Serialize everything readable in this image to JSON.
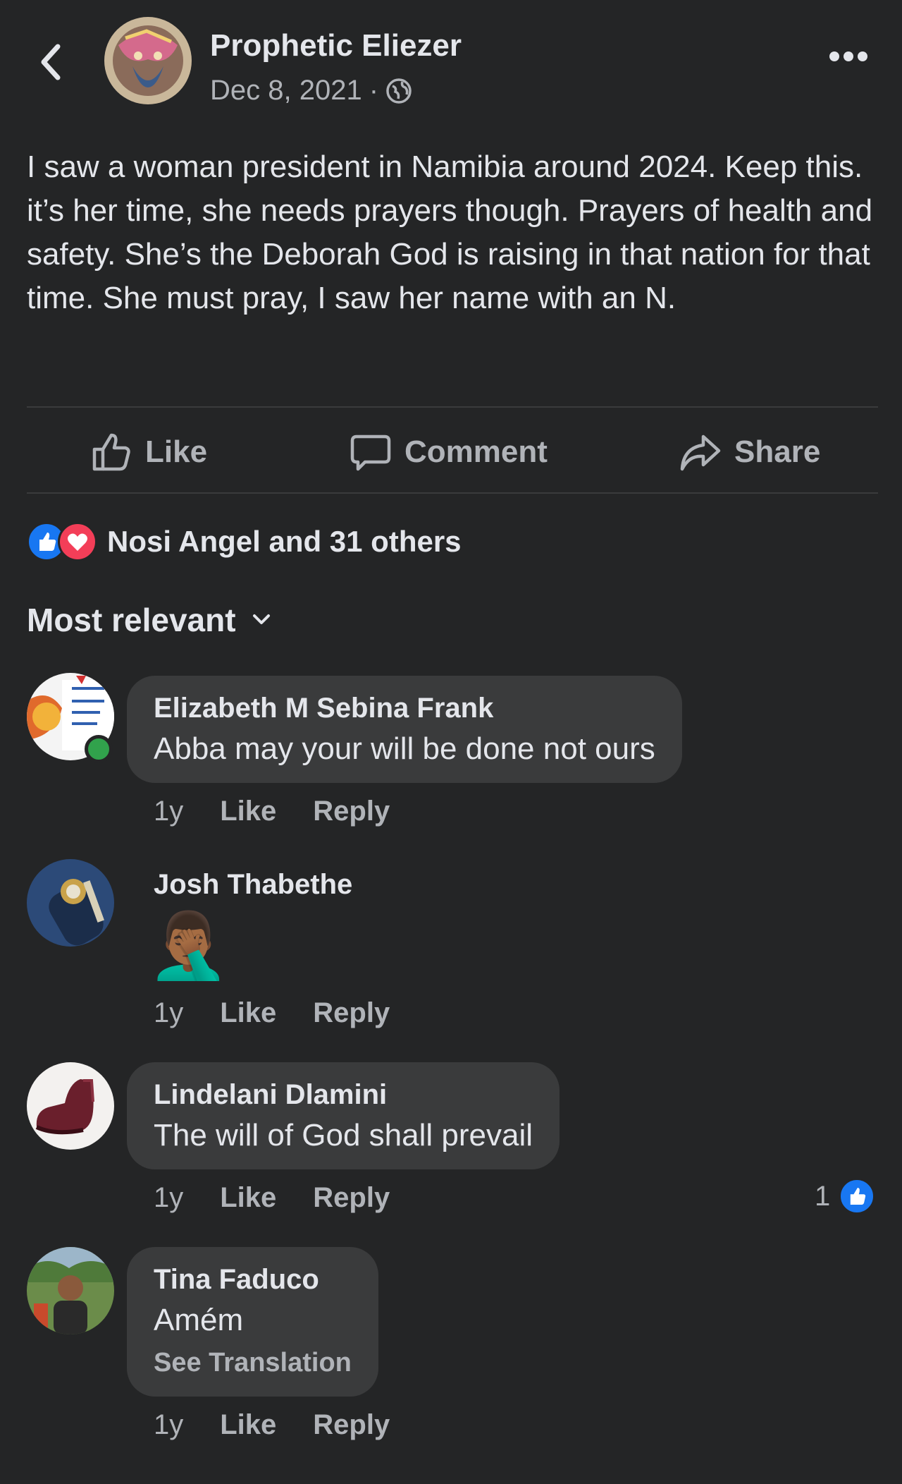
{
  "post": {
    "author": "Prophetic Eliezer",
    "date": "Dec 8, 2021",
    "separator": "·",
    "privacy_icon": "globe-icon",
    "text": "I saw a woman president in Namibia around 2024. Keep this. it’s her time, she needs prayers though. Prayers of health and safety. She’s the Deborah God is raising in that nation for that time. She must pray, I saw her name with an N."
  },
  "actions": {
    "like": "Like",
    "comment": "Comment",
    "share": "Share"
  },
  "reactions": {
    "summary": "Nosi Angel and 31 others",
    "types": [
      "like",
      "love"
    ],
    "colors": {
      "like": "#1877f2",
      "love": "#f33e58"
    }
  },
  "sort": {
    "label": "Most relevant"
  },
  "comments": [
    {
      "name": "Elizabeth M Sebina Frank",
      "text": "Abba may your will be done not ours",
      "time": "1y",
      "like": "Like",
      "reply": "Reply",
      "online": true
    },
    {
      "name": "Josh Thabethe",
      "text": "🤦🏾‍♂️",
      "time": "1y",
      "like": "Like",
      "reply": "Reply"
    },
    {
      "name": "Lindelani Dlamini",
      "text": "The will of God shall prevail",
      "time": "1y",
      "like": "Like",
      "reply": "Reply",
      "reaction_count": "1"
    },
    {
      "name": "Tina Faduco",
      "text": "Amém",
      "translation": "See Translation",
      "time": "1y",
      "like": "Like",
      "reply": "Reply"
    }
  ],
  "colors": {
    "background": "#242526",
    "bubble": "#3a3b3c",
    "text_primary": "#e4e6eb",
    "text_secondary": "#b0b3b8",
    "like_blue": "#1877f2",
    "online_green": "#31a24c"
  }
}
